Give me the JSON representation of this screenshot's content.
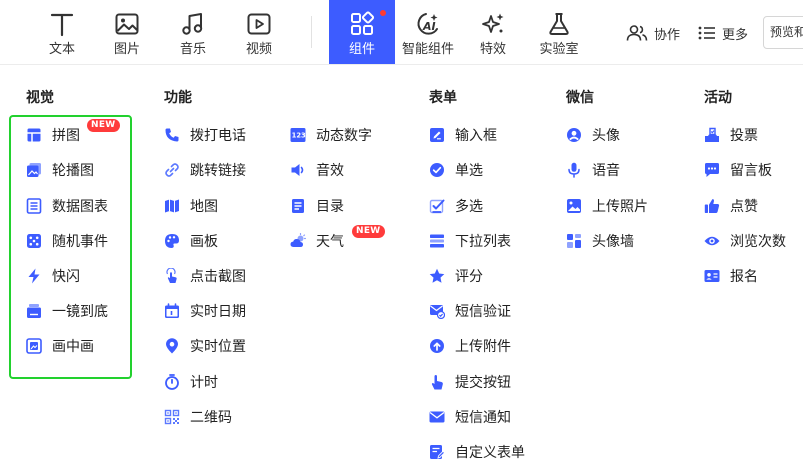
{
  "toolbar": {
    "tools": [
      {
        "label": "文本",
        "icon": "text-icon"
      },
      {
        "label": "图片",
        "icon": "image-icon"
      },
      {
        "label": "音乐",
        "icon": "music-icon"
      },
      {
        "label": "视频",
        "icon": "video-icon"
      },
      {
        "label": "组件",
        "icon": "components-icon",
        "active": true
      },
      {
        "label": "智能组件",
        "icon": "ai-icon"
      },
      {
        "label": "特效",
        "icon": "sparkle-icon"
      },
      {
        "label": "实验室",
        "icon": "flask-icon"
      }
    ],
    "collaborate_label": "协作",
    "more_label": "更多",
    "preview_label": "预览和",
    "accent_color": "#3d5cff"
  },
  "panel": {
    "columns": [
      {
        "title": "视觉",
        "items": [
          {
            "label": "拼图",
            "icon": "layout-icon",
            "badge": "NEW"
          },
          {
            "label": "轮播图",
            "icon": "carousel-icon"
          },
          {
            "label": "数据图表",
            "icon": "chart-list-icon"
          },
          {
            "label": "随机事件",
            "icon": "dice-icon"
          },
          {
            "label": "快闪",
            "icon": "lightning-icon"
          },
          {
            "label": "一镜到底",
            "icon": "scroll-card-icon"
          },
          {
            "label": "画中画",
            "icon": "picture-in-picture-icon"
          }
        ]
      },
      {
        "title": "功能",
        "items": [
          {
            "label": "拨打电话",
            "icon": "phone-icon"
          },
          {
            "label": "跳转链接",
            "icon": "link-icon"
          },
          {
            "label": "地图",
            "icon": "map-icon"
          },
          {
            "label": "画板",
            "icon": "palette-icon"
          },
          {
            "label": "点击截图",
            "icon": "tap-screenshot-icon"
          },
          {
            "label": "实时日期",
            "icon": "calendar-icon"
          },
          {
            "label": "实时位置",
            "icon": "location-pin-icon"
          },
          {
            "label": "计时",
            "icon": "stopwatch-icon"
          },
          {
            "label": "二维码",
            "icon": "qrcode-icon"
          }
        ]
      },
      {
        "title": "",
        "items": [
          {
            "label": "动态数字",
            "icon": "number-123-icon"
          },
          {
            "label": "音效",
            "icon": "speaker-icon"
          },
          {
            "label": "目录",
            "icon": "catalog-icon"
          },
          {
            "label": "天气",
            "icon": "weather-icon",
            "badge": "NEW"
          }
        ]
      },
      {
        "title": "表单",
        "items": [
          {
            "label": "输入框",
            "icon": "input-edit-icon"
          },
          {
            "label": "单选",
            "icon": "radio-check-icon"
          },
          {
            "label": "多选",
            "icon": "checkbox-icon"
          },
          {
            "label": "下拉列表",
            "icon": "dropdown-list-icon"
          },
          {
            "label": "评分",
            "icon": "star-icon"
          },
          {
            "label": "短信验证",
            "icon": "sms-verify-icon"
          },
          {
            "label": "上传附件",
            "icon": "cloud-upload-icon"
          },
          {
            "label": "提交按钮",
            "icon": "tap-hand-icon"
          },
          {
            "label": "短信通知",
            "icon": "mail-icon"
          },
          {
            "label": "自定义表单",
            "icon": "custom-form-icon"
          }
        ]
      },
      {
        "title": "微信",
        "items": [
          {
            "label": "头像",
            "icon": "avatar-icon"
          },
          {
            "label": "语音",
            "icon": "microphone-icon"
          },
          {
            "label": "上传照片",
            "icon": "photo-upload-icon"
          },
          {
            "label": "头像墙",
            "icon": "avatar-wall-icon"
          }
        ]
      },
      {
        "title": "活动",
        "items": [
          {
            "label": "投票",
            "icon": "vote-icon"
          },
          {
            "label": "留言板",
            "icon": "message-board-icon"
          },
          {
            "label": "点赞",
            "icon": "thumbs-up-icon"
          },
          {
            "label": "浏览次数",
            "icon": "eye-icon"
          },
          {
            "label": "报名",
            "icon": "signup-card-icon"
          }
        ]
      }
    ],
    "icon_color": "#3d5cff",
    "badge_color": "#ff3b3b",
    "highlight_color": "#22d12e"
  }
}
